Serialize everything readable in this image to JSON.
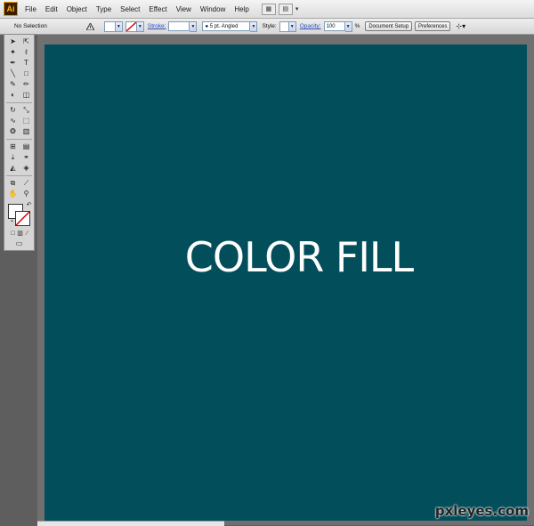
{
  "app": {
    "logo_text": "Ai"
  },
  "menu": [
    "File",
    "Edit",
    "Object",
    "Type",
    "Select",
    "Effect",
    "View",
    "Window",
    "Help"
  ],
  "control_bar": {
    "selection_label": "No Selection",
    "stroke_label": "Stroke:",
    "brush_value": "5 pt. Angled",
    "style_label": "Style:",
    "opacity_label": "Opacity:",
    "opacity_value": "100",
    "percent": "%",
    "document_setup": "Document Setup",
    "preferences": "Preferences"
  },
  "canvas": {
    "text": "COLOR FILL",
    "fill_color": "#024e5a"
  },
  "watermark": "pxleyes.com"
}
